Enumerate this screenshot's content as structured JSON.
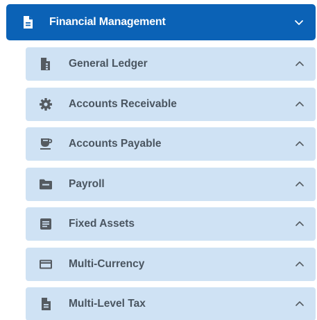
{
  "header": {
    "title": "Financial Management",
    "icon": "document-icon",
    "expanded": true
  },
  "colors": {
    "header_bg": "#0b62b6",
    "item_bg": "#cfe2f4",
    "item_text": "#4a5560",
    "icon": "#555b61"
  },
  "items": [
    {
      "label": "General Ledger",
      "icon": "ledger-document-icon"
    },
    {
      "label": "Accounts Receivable",
      "icon": "gear-icon"
    },
    {
      "label": "Accounts Payable",
      "icon": "coffee-cup-icon"
    },
    {
      "label": "Payroll",
      "icon": "folder-icon"
    },
    {
      "label": "Fixed Assets",
      "icon": "list-document-icon"
    },
    {
      "label": "Multi-Currency",
      "icon": "credit-card-icon"
    },
    {
      "label": "Multi-Level Tax",
      "icon": "file-text-icon"
    }
  ]
}
